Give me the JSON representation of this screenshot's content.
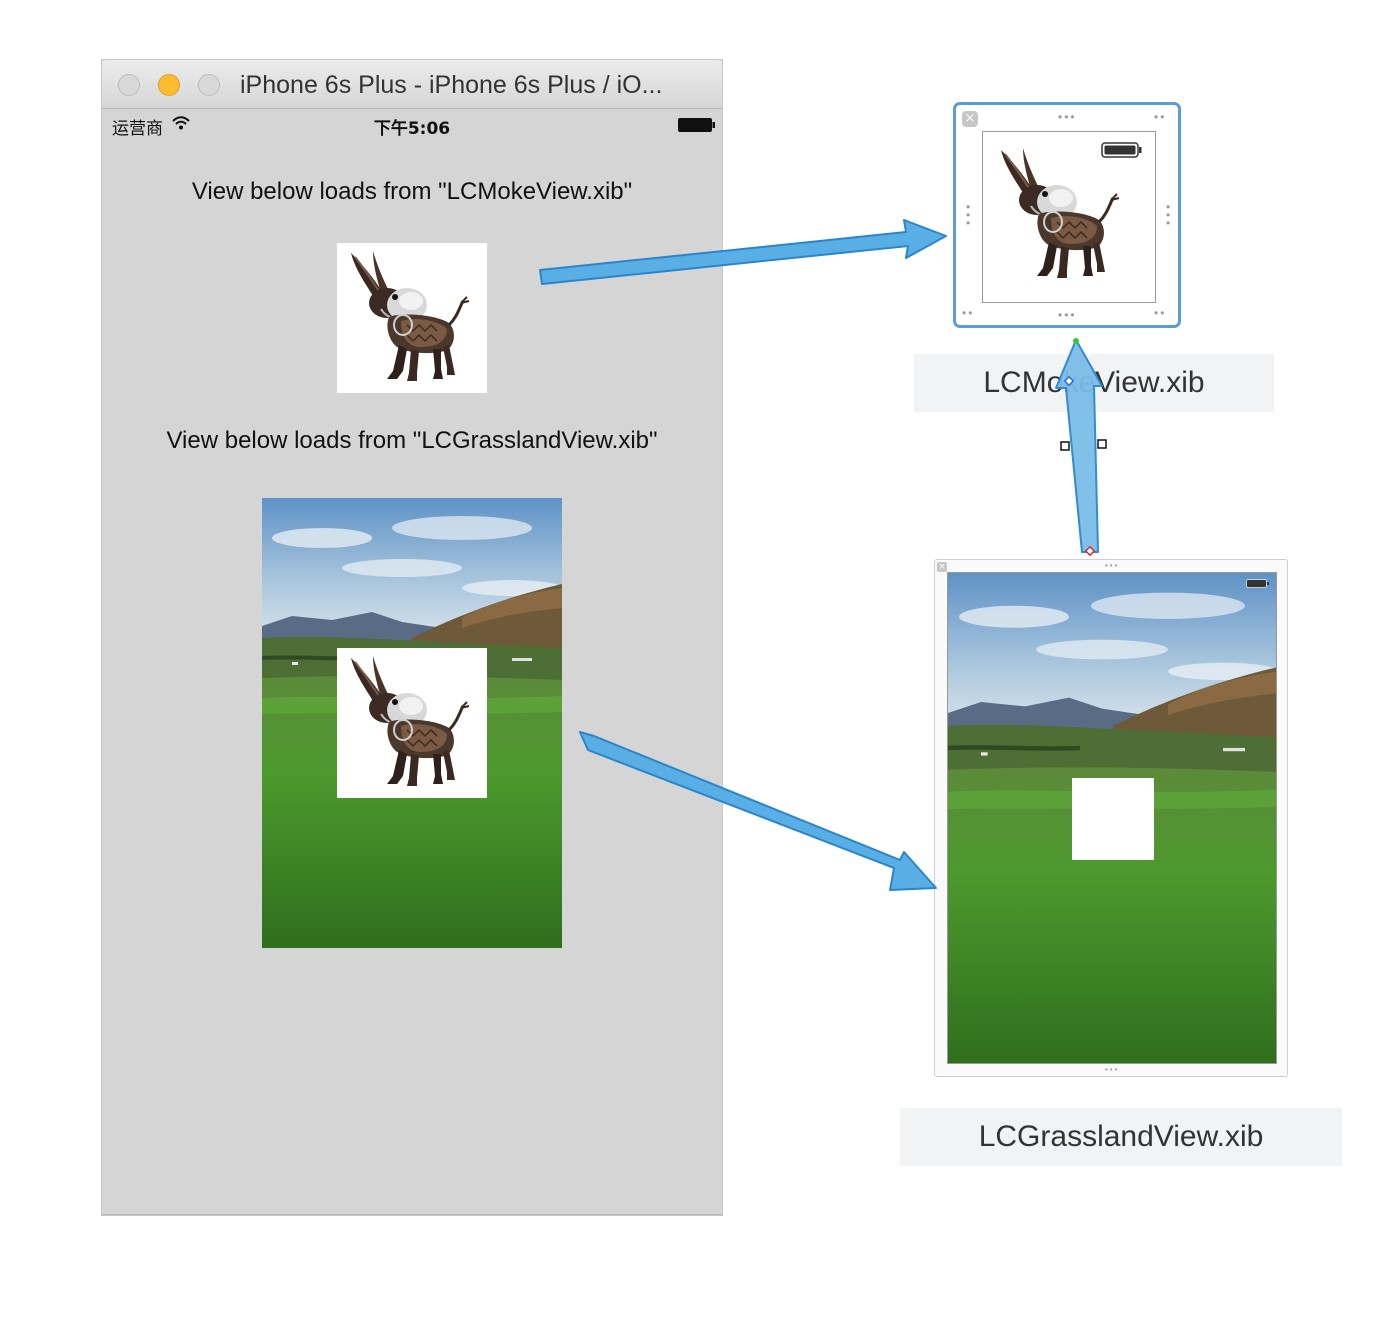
{
  "simulator": {
    "window_title": "iPhone 6s Plus - iPhone 6s Plus / iO...",
    "status_bar": {
      "carrier": "运营商",
      "time": "下午5:06"
    },
    "captions": [
      "View below loads from \"LCMokeView.xib\"",
      "View below loads from \"LCGrasslandView.xib\""
    ]
  },
  "xib_files": {
    "moke_view": {
      "label": "LCMokeView.xib"
    },
    "grassland_view": {
      "label": "LCGrasslandView.xib"
    }
  },
  "colors": {
    "arrow_fill": "#5aaee6",
    "arrow_stroke": "#2a86c8",
    "selection_border": "#5b9bd8",
    "simulator_bg": "#d5d5d5"
  },
  "icons": [
    "wifi-icon",
    "battery-icon",
    "close-icon",
    "donkey-image",
    "grassland-image"
  ]
}
